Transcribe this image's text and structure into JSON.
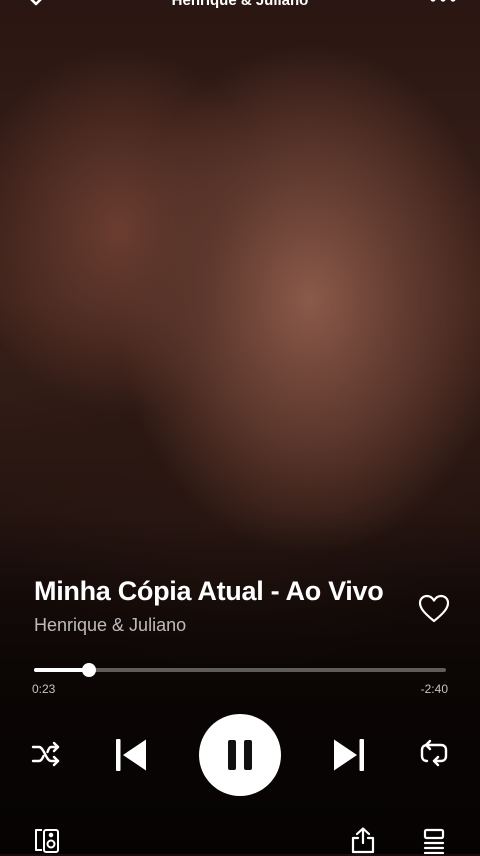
{
  "header": {
    "title": "Henrique & Juliano"
  },
  "track": {
    "title": "Minha Cópia Atual - Ao Vivo",
    "artist": "Henrique & Juliano",
    "liked": false
  },
  "progress": {
    "elapsed": "0:23",
    "remaining": "-2:40",
    "fraction": 0.134
  },
  "icons": {
    "collapse": "chevron-down-icon",
    "more": "more-options-icon",
    "like": "heart-icon",
    "shuffle": "shuffle-icon",
    "previous": "skip-previous-icon",
    "pause": "pause-icon",
    "next": "skip-next-icon",
    "repeat": "repeat-icon",
    "devices": "connect-devices-icon",
    "share": "share-icon",
    "queue": "queue-icon"
  },
  "colors": {
    "accent": "#ffffff",
    "background": "#1a0e0c"
  }
}
